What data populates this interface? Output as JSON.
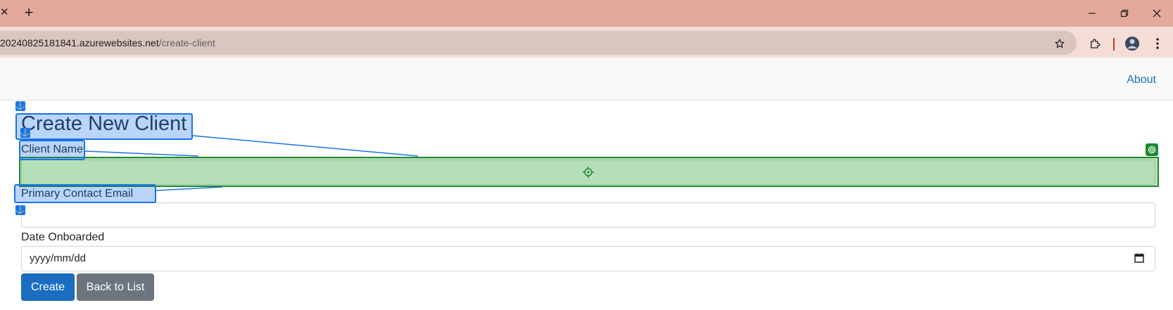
{
  "browser": {
    "tab_close_glyph": "✕",
    "new_tab_glyph": "+",
    "url_host": "20240825181841.azurewebsites.net",
    "url_path": "/create-client"
  },
  "nav": {
    "about_label": "About"
  },
  "page": {
    "title": "Create New Client",
    "fields": [
      {
        "label": "Client Name",
        "value": ""
      },
      {
        "label": "Primary Contact Email",
        "value": ""
      },
      {
        "label": "Date Onboarded",
        "value": "yyyy/mm/dd"
      }
    ],
    "create_label": "Create",
    "back_label": "Back to List"
  },
  "colors": {
    "tab_bar": "#e4a99a",
    "link": "#1f6fbf",
    "primary": "#1b6ec2",
    "secondary": "#6c757d",
    "annotation_blue": "#1a73e8",
    "annotation_green": "#1e8a2e"
  }
}
